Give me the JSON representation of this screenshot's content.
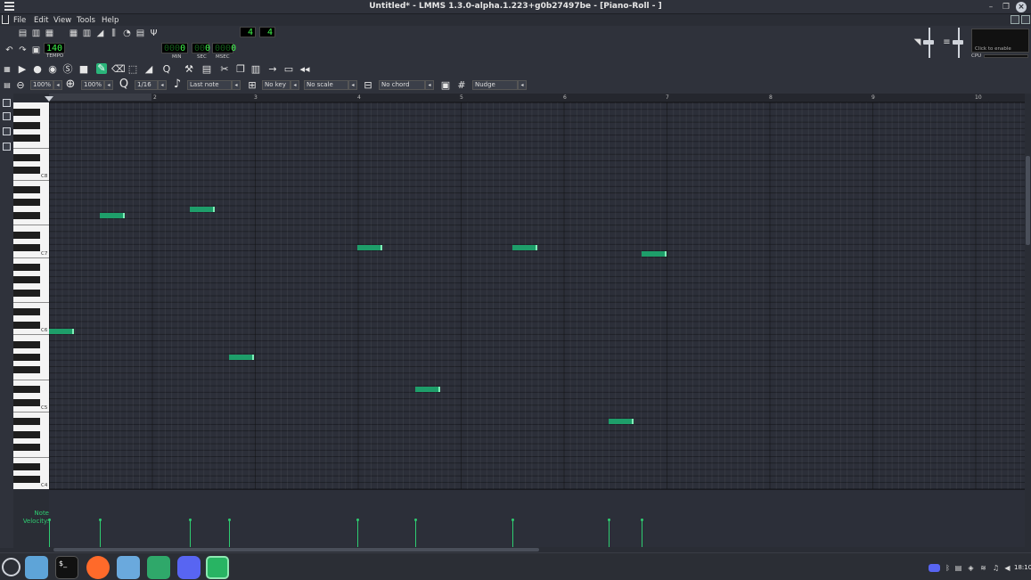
{
  "window": {
    "title": "Untitled* - LMMS 1.3.0-alpha.1.223+g0b27497be - [Piano-Roll - ]"
  },
  "menubar": {
    "items": [
      "File",
      "Edit",
      "View",
      "Tools",
      "Help"
    ]
  },
  "transport": {
    "tempo_value": "140",
    "tempo_label": "TEMPO",
    "time_sig_num": "4",
    "time_sig_den": "4",
    "time_min": "0",
    "time_min_dim": "000",
    "time_sec": "0",
    "time_sec_dim": "00",
    "time_msec": "0",
    "time_msec_dim": "000",
    "min_label": "MIN",
    "sec_label": "SEC",
    "msec_label": "MSEC",
    "cpu_hint": "Click to enable",
    "cpu_label": "CPU"
  },
  "piano_roll": {
    "zoom_h": "100%",
    "zoom_v": "100%",
    "quantize": "1/16",
    "note_length": "Last note",
    "key": "No key",
    "scale": "No scale",
    "chord": "No chord",
    "snap": "Nudge",
    "timeline_ticks": [
      "2",
      "3",
      "4",
      "5",
      "6",
      "7",
      "8",
      "9",
      "10"
    ],
    "octave_labels": [
      "C8",
      "C7",
      "C6",
      "C5",
      "C4"
    ],
    "velocity_label_line1": "Note",
    "velocity_label_line2": "Velocity:"
  },
  "taskbar": {
    "clock": "18:10"
  },
  "colors": {
    "note": "#1e9e6a",
    "accent": "#2ab57a",
    "lcd": "#3ef54b"
  }
}
